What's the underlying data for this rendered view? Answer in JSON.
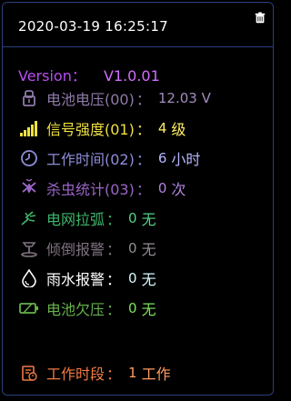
{
  "header": {
    "datetime": "2020-03-19 16:25:17"
  },
  "version": {
    "label": "Version：",
    "value": "V1.0.01"
  },
  "rows": [
    {
      "label": "电池电压(00)",
      "colon": "：",
      "value": "12.03 V",
      "unit": "",
      "color": "#8f7aa8",
      "value_color": "#a38bbd"
    },
    {
      "label": "信号强度(01)",
      "colon": "：",
      "value": "4",
      "unit": "级",
      "color": "#f0e040",
      "value_color": "#fff06a"
    },
    {
      "label": "工作时间(02)",
      "colon": "：",
      "value": "6",
      "unit": "小时",
      "color": "#8e8dd8",
      "value_color": "#b7b7ff"
    },
    {
      "label": "杀虫统计(03)",
      "colon": "：",
      "value": "0",
      "unit": "次",
      "color": "#9b65c8",
      "value_color": "#b383e0"
    },
    {
      "label": "电网拉弧",
      "colon": "：",
      "value": "0",
      "unit": "无",
      "color": "#3cb56b",
      "value_color": "#53d287"
    },
    {
      "label": "倾倒报警",
      "colon": "：",
      "value": "0",
      "unit": "无",
      "color": "#7f7280",
      "value_color": "#958d96"
    },
    {
      "label": "雨水报警",
      "colon": "：",
      "value": "0",
      "unit": "无",
      "color": "#ffffff",
      "value_color": "#d9faff"
    },
    {
      "label": "电池欠压",
      "colon": "：",
      "value": "0",
      "unit": "无",
      "color": "#66b24b",
      "value_color": "#7be45a"
    },
    {
      "label": "工作时段",
      "colon": "：",
      "value": "1",
      "unit": "工作",
      "color": "#f07b43",
      "value_color": "#ff9b62"
    }
  ]
}
